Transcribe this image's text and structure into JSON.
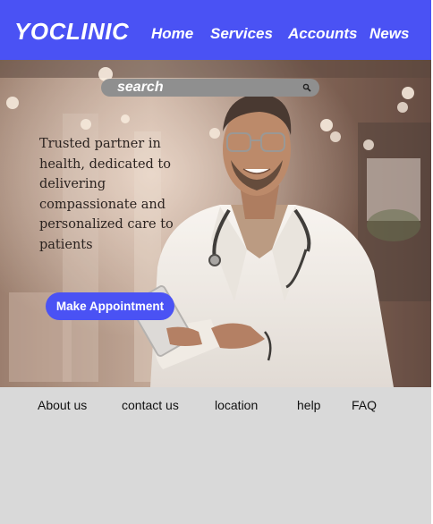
{
  "header": {
    "logo": "YOCLINIC",
    "nav": {
      "home": "Home",
      "services": "Services",
      "accounts": "Accounts",
      "news": "News"
    },
    "background_color": "#4a52f4"
  },
  "hero": {
    "search": {
      "placeholder": "search",
      "icon": "search-icon"
    },
    "tagline": "Trusted partner in health, dedicated to delivering compassionate and personalized care to patients",
    "cta_label": "Make Appointment",
    "cta_color": "#4a52f4"
  },
  "footer": {
    "links": {
      "about": "About us",
      "contact": "contact us",
      "location": "location",
      "help": "help",
      "faq": "FAQ"
    },
    "background_color": "#d9d9d9"
  }
}
